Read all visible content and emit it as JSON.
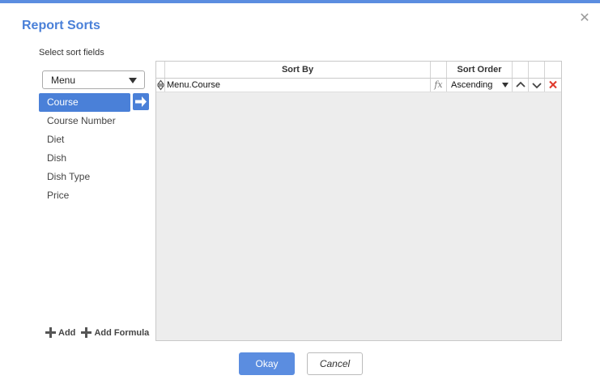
{
  "dialog": {
    "title": "Report Sorts",
    "subtitle": "Select sort fields"
  },
  "source": {
    "selected": "Menu"
  },
  "fields": [
    {
      "label": "Course",
      "selected": true
    },
    {
      "label": "Course Number",
      "selected": false
    },
    {
      "label": "Diet",
      "selected": false
    },
    {
      "label": "Dish",
      "selected": false
    },
    {
      "label": "Dish Type",
      "selected": false
    },
    {
      "label": "Price",
      "selected": false
    }
  ],
  "actions": {
    "add_label": "Add",
    "add_formula_label": "Add Formula"
  },
  "grid": {
    "headers": {
      "sort_by": "Sort By",
      "sort_order": "Sort Order"
    },
    "rows": [
      {
        "sort_by": "Menu.Course",
        "formula_symbol": "fx",
        "sort_order": "Ascending"
      }
    ]
  },
  "footer": {
    "okay_label": "Okay",
    "cancel_label": "Cancel"
  },
  "colors": {
    "accent": "#4a80d8",
    "delete": "#e0392b"
  }
}
